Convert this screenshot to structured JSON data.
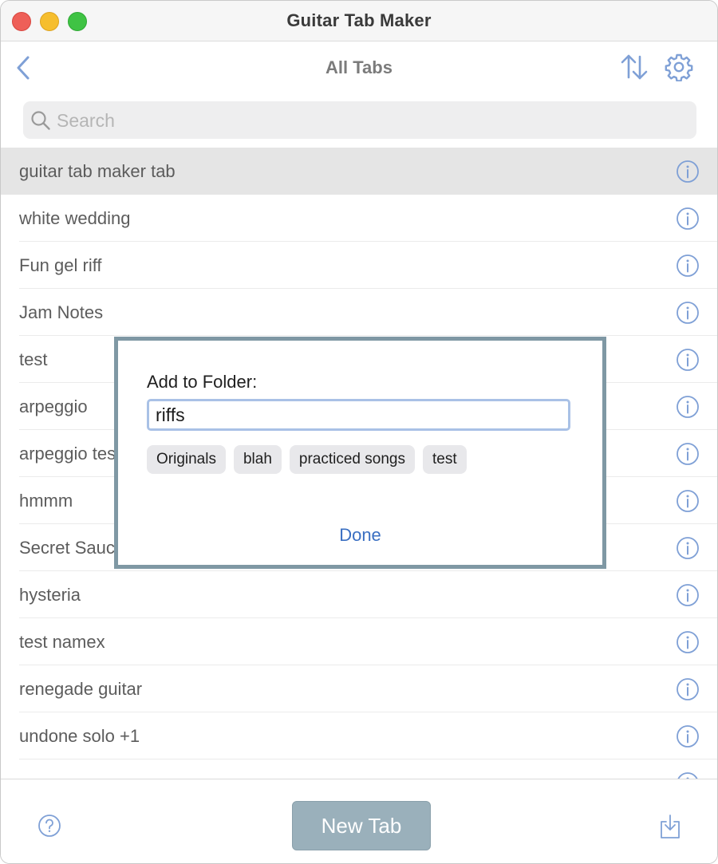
{
  "window": {
    "title": "Guitar Tab Maker"
  },
  "nav": {
    "title": "All Tabs"
  },
  "search": {
    "placeholder": "Search"
  },
  "tabs": [
    {
      "label": "guitar tab maker tab",
      "selected": true
    },
    {
      "label": "white wedding"
    },
    {
      "label": "Fun gel riff"
    },
    {
      "label": "Jam Notes"
    },
    {
      "label": "test"
    },
    {
      "label": "arpeggio"
    },
    {
      "label": "arpeggio tes"
    },
    {
      "label": "hmmm"
    },
    {
      "label": "Secret Sauc"
    },
    {
      "label": "hysteria"
    },
    {
      "label": "test namex"
    },
    {
      "label": "renegade guitar"
    },
    {
      "label": "undone solo +1"
    },
    {
      "label": ""
    }
  ],
  "bottom": {
    "new_tab_label": "New Tab"
  },
  "dialog": {
    "title": "Add to Folder:",
    "input_value": "riffs",
    "folders": [
      "Originals",
      "blah",
      "practiced songs",
      "test"
    ],
    "done_label": "Done"
  },
  "colors": {
    "accent": "#3a6fc2",
    "icon_blue": "#7fa0d6",
    "dialog_border": "#7f98a4",
    "button_fill": "#9ab0bb"
  },
  "icons": {
    "back": "chevron-left-icon",
    "sort": "sort-arrows-icon",
    "settings": "gear-icon",
    "search": "search-icon",
    "info": "info-icon",
    "help": "help-icon",
    "import": "import-icon"
  }
}
